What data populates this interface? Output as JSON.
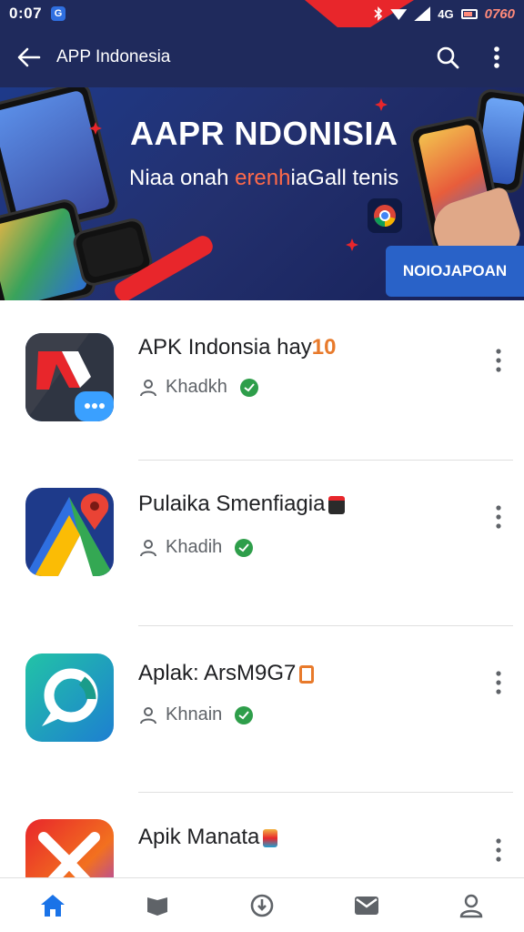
{
  "status_bar": {
    "time": "0:07",
    "network_label": "4G",
    "battery_text": "0760"
  },
  "app_bar": {
    "title": "APP Indonesia",
    "icons": [
      "back-arrow-icon",
      "search-icon",
      "more-vertical-icon"
    ]
  },
  "banner": {
    "title": "AAPR NDONISIA",
    "subtitle_prefix": "Niaa onah ",
    "subtitle_accent": "erenh",
    "subtitle_suffix": "iaGall tenis",
    "cta_label": "NOIOJAPOAN"
  },
  "apps": [
    {
      "name": "APK Indonsia hay",
      "name_tag": "10",
      "developer": "Khadkh",
      "verified": true,
      "icon": "apk-indonesia-icon"
    },
    {
      "name": "Pulaika Smenfiagia",
      "name_tag": "",
      "developer": "Khadih",
      "verified": true,
      "icon": "maps-icon"
    },
    {
      "name": "Aplak: ArsM9G7",
      "name_tag": "",
      "developer": "Khnain",
      "verified": true,
      "icon": "chat-ring-icon"
    },
    {
      "name": "Apik Manata",
      "name_tag": "",
      "developer": "",
      "verified": false,
      "icon": "x-app-icon"
    }
  ],
  "bottom_nav": {
    "items": [
      "home-icon",
      "library-icon",
      "updates-icon",
      "inbox-icon",
      "profile-icon"
    ],
    "active": "home-icon"
  },
  "colors": {
    "app_bar": "#1f2a5c",
    "accent_blue": "#2962c8",
    "accent_red": "#e8262b",
    "verified_green": "#2e9e4a",
    "nav_active": "#1a73e8",
    "nav_inactive": "#5f6368"
  }
}
